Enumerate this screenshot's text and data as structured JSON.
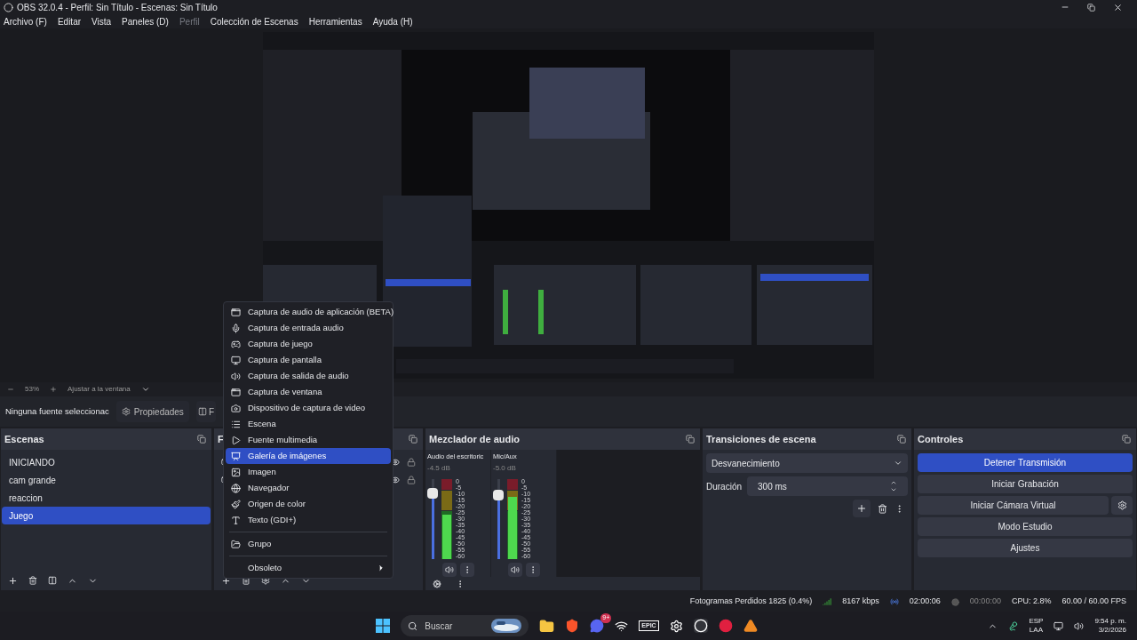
{
  "window": {
    "title": "OBS 32.0.4 - Perfil: Sin Título - Escenas: Sin Título"
  },
  "menu": [
    {
      "label": "Archivo (F)",
      "disabled": false
    },
    {
      "label": "Editar",
      "disabled": false
    },
    {
      "label": "Vista",
      "disabled": false
    },
    {
      "label": "Paneles (D)",
      "disabled": false
    },
    {
      "label": "Perfil",
      "disabled": true
    },
    {
      "label": "Colección de Escenas",
      "disabled": false
    },
    {
      "label": "Herramientas",
      "disabled": false
    },
    {
      "label": "Ayuda (H)",
      "disabled": false
    }
  ],
  "preview_toolbar": {
    "zoom": "53%",
    "fit": "Ajustar a la ventana"
  },
  "context_bar": {
    "status": "Ninguna fuente seleccionac",
    "properties": "Propiedades",
    "filters": "F"
  },
  "scenes": {
    "title": "Escenas",
    "items": [
      {
        "name": "INICIANDO",
        "selected": false
      },
      {
        "name": "cam grande",
        "selected": false
      },
      {
        "name": "reaccion",
        "selected": false
      },
      {
        "name": "Juego",
        "selected": true
      }
    ]
  },
  "sources": {
    "title": "F"
  },
  "mixer": {
    "title": "Mezclador de audio",
    "channels": [
      {
        "name": "Audio del escritoric",
        "reading": "-4.5 dB",
        "level": 0.82,
        "scale": [
          "0",
          "-5",
          "-10",
          "-15",
          "-20",
          "-25",
          "-30",
          "-35",
          "-40",
          "-45",
          "-50",
          "-55",
          "-60"
        ]
      },
      {
        "name": "Mic/Aux",
        "reading": "-5.0 dB",
        "level": 0.8,
        "scale": [
          "0",
          "-5",
          "-10",
          "-15",
          "-20",
          "-25",
          "-30",
          "-35",
          "-40",
          "-45",
          "-50",
          "-55",
          "-60"
        ]
      }
    ]
  },
  "transitions": {
    "title": "Transiciones de escena",
    "transition": "Desvanecimiento",
    "duration_label": "Duración",
    "duration": "300 ms"
  },
  "controls": {
    "title": "Controles",
    "buttons": [
      {
        "label": "Detener Transmisión",
        "active": true,
        "settings": false
      },
      {
        "label": "Iniciar Grabación",
        "active": false,
        "settings": false
      },
      {
        "label": "Iniciar Cámara Virtual",
        "active": false,
        "settings": true
      },
      {
        "label": "Modo Estudio",
        "active": false,
        "settings": false
      },
      {
        "label": "Ajustes",
        "active": false,
        "settings": false
      }
    ]
  },
  "context_menu": {
    "items": [
      {
        "kind": "item",
        "label": "Captura de audio de aplicación (BETA)",
        "selected": false,
        "submenu": false
      },
      {
        "kind": "item",
        "label": "Captura de entrada audio",
        "selected": false,
        "submenu": false
      },
      {
        "kind": "item",
        "label": "Captura de juego",
        "selected": false,
        "submenu": false
      },
      {
        "kind": "item",
        "label": "Captura de pantalla",
        "selected": false,
        "submenu": false
      },
      {
        "kind": "item",
        "label": "Captura de salida de audio",
        "selected": false,
        "submenu": false
      },
      {
        "kind": "item",
        "label": "Captura de ventana",
        "selected": false,
        "submenu": false
      },
      {
        "kind": "item",
        "label": "Dispositivo de captura de video",
        "selected": false,
        "submenu": false
      },
      {
        "kind": "item",
        "label": "Escena",
        "selected": false,
        "submenu": false
      },
      {
        "kind": "item",
        "label": "Fuente multimedia",
        "selected": false,
        "submenu": false
      },
      {
        "kind": "item",
        "label": "Galería de imágenes",
        "selected": true,
        "submenu": false
      },
      {
        "kind": "item",
        "label": "Imagen",
        "selected": false,
        "submenu": false
      },
      {
        "kind": "item",
        "label": "Navegador",
        "selected": false,
        "submenu": false
      },
      {
        "kind": "item",
        "label": "Origen de color",
        "selected": false,
        "submenu": false
      },
      {
        "kind": "item",
        "label": "Texto (GDI+)",
        "selected": false,
        "submenu": false
      },
      {
        "kind": "separator"
      },
      {
        "kind": "item",
        "label": "Grupo",
        "selected": false,
        "submenu": false
      },
      {
        "kind": "separator"
      },
      {
        "kind": "item",
        "label": "Obsoleto",
        "selected": false,
        "submenu": true
      }
    ]
  },
  "status_bar": {
    "dropped_frames": "Fotogramas Perdidos 1825 (0.4%)",
    "bitrate": "8167 kbps",
    "stream_time": "02:00:06",
    "record_time": "00:00:00",
    "cpu": "CPU: 2.8%",
    "fps": "60.00 / 60.00 FPS"
  },
  "taskbar": {
    "search_placeholder": "Buscar",
    "epic": "EPIC",
    "discord_badge": "9+",
    "language": "ESP",
    "layout": "LAA",
    "time": "9:54 p. m.",
    "date": "3/2/2026"
  }
}
